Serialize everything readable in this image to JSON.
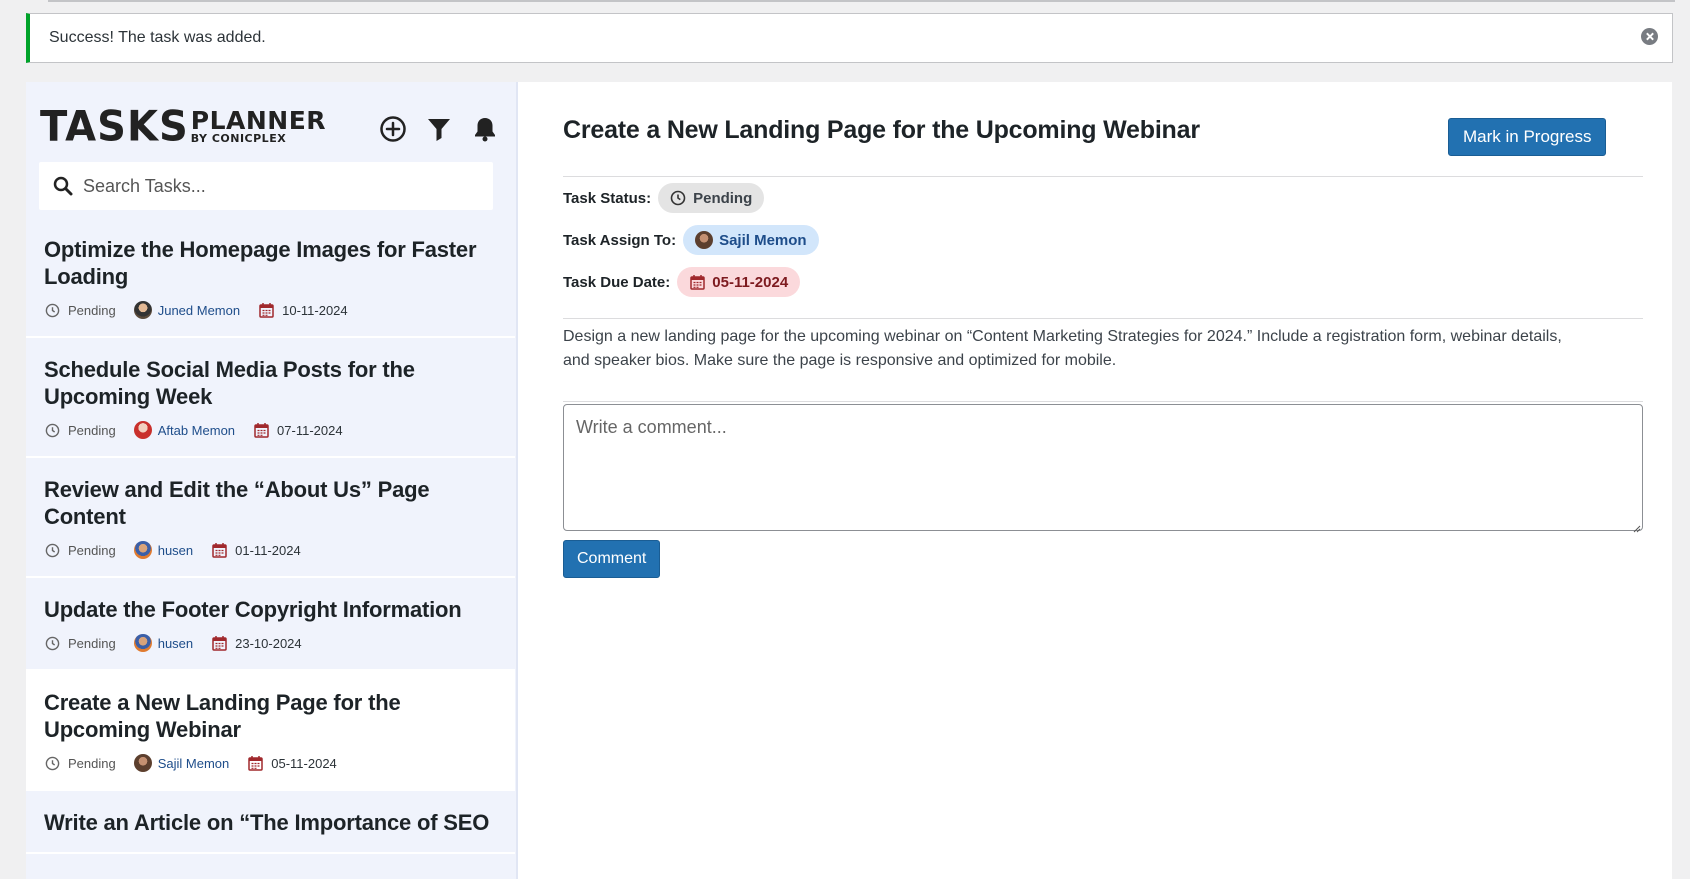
{
  "notice": {
    "text": "Success! The task was added."
  },
  "sidebar": {
    "logo": {
      "tasks": "TASKS",
      "planner": "PLANNER",
      "by": "BY CONICPLEX"
    },
    "search": {
      "placeholder": "Search Tasks..."
    },
    "tasks": [
      {
        "title": "Optimize the Homepage Images for Faster Loading",
        "status": "Pending",
        "assignee": "Juned Memon",
        "due": "10-11-2024"
      },
      {
        "title": "Schedule Social Media Posts for the Upcoming Week",
        "status": "Pending",
        "assignee": "Aftab Memon",
        "due": "07-11-2024"
      },
      {
        "title": "Review and Edit the “About Us” Page Content",
        "status": "Pending",
        "assignee": "husen",
        "due": "01-11-2024"
      },
      {
        "title": "Update the Footer Copyright Information",
        "status": "Pending",
        "assignee": "husen",
        "due": "23-10-2024"
      },
      {
        "title": "Create a New Landing Page for the Upcoming Webinar",
        "status": "Pending",
        "assignee": "Sajil Memon",
        "due": "05-11-2024"
      },
      {
        "title": "Write an Article on “The Importance of SEO",
        "status": "",
        "assignee": "",
        "due": ""
      }
    ]
  },
  "main": {
    "title": "Create a New Landing Page for the Upcoming Webinar",
    "progress_button": "Mark in Progress",
    "status_label": "Task Status:",
    "status_value": "Pending",
    "assign_label": "Task Assign To:",
    "assign_value": "Sajil Memon",
    "due_label": "Task Due Date:",
    "due_value": "05-11-2024",
    "description": "Design a new landing page for the upcoming webinar on “Content Marketing Strategies for 2024.” Include a registration form, webinar details, and speaker bios. Make sure the page is responsive and optimized for mobile.",
    "comment_placeholder": "Write a comment...",
    "comment_button": "Comment"
  },
  "colors": {
    "accent": "#2271b1",
    "success_border": "#00a32a",
    "sidebar_bg": "#f0f3fc",
    "badge_assign_bg": "#d2e6fb",
    "badge_due_bg": "#fbd9dc"
  },
  "icons": [
    "close-icon",
    "add-icon",
    "filter-icon",
    "bell-icon",
    "search-icon",
    "clock-icon",
    "calendar-icon"
  ]
}
